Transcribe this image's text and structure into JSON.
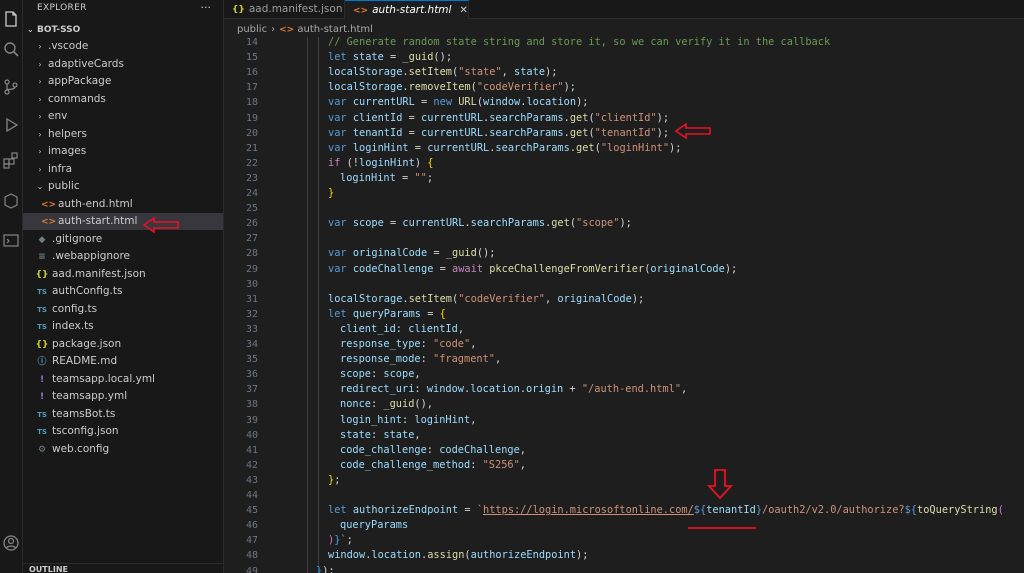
{
  "explorer": {
    "title": "EXPLORER",
    "more": "···",
    "project": "BOT-SSO",
    "tree": [
      {
        "label": ".vscode",
        "kind": "folder",
        "icon": "›"
      },
      {
        "label": "adaptiveCards",
        "kind": "folder",
        "icon": "›"
      },
      {
        "label": "appPackage",
        "kind": "folder",
        "icon": "›"
      },
      {
        "label": "commands",
        "kind": "folder",
        "icon": "›"
      },
      {
        "label": "env",
        "kind": "folder",
        "icon": "›"
      },
      {
        "label": "helpers",
        "kind": "folder",
        "icon": "›"
      },
      {
        "label": "images",
        "kind": "folder",
        "icon": "›"
      },
      {
        "label": "infra",
        "kind": "folder",
        "icon": "›"
      },
      {
        "label": "public",
        "kind": "folder-open",
        "icon": "⌄"
      },
      {
        "label": "auth-end.html",
        "kind": "html",
        "icon": "<>"
      },
      {
        "label": "auth-start.html",
        "kind": "html",
        "icon": "<>"
      },
      {
        "label": ".gitignore",
        "kind": "dots",
        "icon": "◆"
      },
      {
        "label": ".webappignore",
        "kind": "plain",
        "icon": "≡"
      },
      {
        "label": "aad.manifest.json",
        "kind": "json",
        "icon": "{}"
      },
      {
        "label": "authConfig.ts",
        "kind": "ts",
        "icon": "TS"
      },
      {
        "label": "config.ts",
        "kind": "ts",
        "icon": "TS"
      },
      {
        "label": "index.ts",
        "kind": "ts",
        "icon": "TS"
      },
      {
        "label": "package.json",
        "kind": "json",
        "icon": "{}"
      },
      {
        "label": "README.md",
        "kind": "info",
        "icon": "ⓘ"
      },
      {
        "label": "teamsapp.local.yml",
        "kind": "yml",
        "icon": "!"
      },
      {
        "label": "teamsapp.yml",
        "kind": "yml",
        "icon": "!"
      },
      {
        "label": "teamsBot.ts",
        "kind": "ts",
        "icon": "TS"
      },
      {
        "label": "tsconfig.json",
        "kind": "tsjson",
        "icon": "TS"
      },
      {
        "label": "web.config",
        "kind": "gear",
        "icon": "⚙"
      }
    ],
    "outline": "OUTLINE"
  },
  "tabs": [
    {
      "label": "aad.manifest.json",
      "icon": "{}"
    },
    {
      "label": "auth-start.html",
      "icon": "<>",
      "close": "✕"
    }
  ],
  "breadcrumb": {
    "folder": "public",
    "separator": "›",
    "file_icon": "<>",
    "file": "auth-start.html"
  },
  "code": [
    {
      "n": "14",
      "indent": 0,
      "t": [
        [
          "cm",
          "// Generate random state string and store it, so we can verify it in the callback"
        ]
      ]
    },
    {
      "n": "15",
      "indent": 0,
      "t": [
        [
          "kw",
          "let "
        ],
        [
          "var",
          "state"
        ],
        [
          "pl",
          " = "
        ],
        [
          "fn",
          "_guid"
        ],
        [
          "pl",
          "();"
        ]
      ]
    },
    {
      "n": "16",
      "indent": 0,
      "t": [
        [
          "var",
          "localStorage"
        ],
        [
          "pl",
          "."
        ],
        [
          "fn",
          "setItem"
        ],
        [
          "pl",
          "("
        ],
        [
          "str",
          "\"state\""
        ],
        [
          "pl",
          ", "
        ],
        [
          "var",
          "state"
        ],
        [
          "pl",
          ");"
        ]
      ]
    },
    {
      "n": "17",
      "indent": 0,
      "t": [
        [
          "var",
          "localStorage"
        ],
        [
          "pl",
          "."
        ],
        [
          "fn",
          "removeItem"
        ],
        [
          "pl",
          "("
        ],
        [
          "str",
          "\"codeVerifier\""
        ],
        [
          "pl",
          ");"
        ]
      ]
    },
    {
      "n": "18",
      "indent": 0,
      "t": [
        [
          "kw",
          "var "
        ],
        [
          "var",
          "currentURL"
        ],
        [
          "pl",
          " = "
        ],
        [
          "kw",
          "new "
        ],
        [
          "fn",
          "URL"
        ],
        [
          "pl",
          "("
        ],
        [
          "var",
          "window"
        ],
        [
          "pl",
          "."
        ],
        [
          "var",
          "location"
        ],
        [
          "pl",
          ");"
        ]
      ]
    },
    {
      "n": "19",
      "indent": 0,
      "t": [
        [
          "kw",
          "var "
        ],
        [
          "var",
          "clientId"
        ],
        [
          "pl",
          " = "
        ],
        [
          "var",
          "currentURL"
        ],
        [
          "pl",
          "."
        ],
        [
          "var",
          "searchParams"
        ],
        [
          "pl",
          "."
        ],
        [
          "fn",
          "get"
        ],
        [
          "pl",
          "("
        ],
        [
          "str",
          "\"clientId\""
        ],
        [
          "pl",
          ");"
        ]
      ]
    },
    {
      "n": "20",
      "indent": 0,
      "t": [
        [
          "kw",
          "var "
        ],
        [
          "var",
          "tenantId"
        ],
        [
          "pl",
          " = "
        ],
        [
          "var",
          "currentURL"
        ],
        [
          "pl",
          "."
        ],
        [
          "var",
          "searchParams"
        ],
        [
          "pl",
          "."
        ],
        [
          "fn",
          "get"
        ],
        [
          "pl",
          "("
        ],
        [
          "str",
          "\"tenantId\""
        ],
        [
          "pl",
          ");"
        ]
      ]
    },
    {
      "n": "21",
      "indent": 0,
      "t": [
        [
          "kw",
          "var "
        ],
        [
          "var",
          "loginHint"
        ],
        [
          "pl",
          " = "
        ],
        [
          "var",
          "currentURL"
        ],
        [
          "pl",
          "."
        ],
        [
          "var",
          "searchParams"
        ],
        [
          "pl",
          "."
        ],
        [
          "fn",
          "get"
        ],
        [
          "pl",
          "("
        ],
        [
          "str",
          "\"loginHint\""
        ],
        [
          "pl",
          ");"
        ]
      ]
    },
    {
      "n": "22",
      "indent": 0,
      "t": [
        [
          "ctl",
          "if "
        ],
        [
          "pl",
          "(!"
        ],
        [
          "var",
          "loginHint"
        ],
        [
          "pl",
          ") "
        ],
        [
          "br1",
          "{"
        ]
      ]
    },
    {
      "n": "23",
      "indent": 1,
      "t": [
        [
          "var",
          "loginHint"
        ],
        [
          "pl",
          " = "
        ],
        [
          "str",
          "\"\""
        ],
        [
          "pl",
          ";"
        ]
      ]
    },
    {
      "n": "24",
      "indent": 0,
      "t": [
        [
          "br1",
          "}"
        ]
      ]
    },
    {
      "n": "25",
      "indent": 0,
      "t": []
    },
    {
      "n": "26",
      "indent": 0,
      "t": [
        [
          "kw",
          "var "
        ],
        [
          "var",
          "scope"
        ],
        [
          "pl",
          " = "
        ],
        [
          "var",
          "currentURL"
        ],
        [
          "pl",
          "."
        ],
        [
          "var",
          "searchParams"
        ],
        [
          "pl",
          "."
        ],
        [
          "fn",
          "get"
        ],
        [
          "pl",
          "("
        ],
        [
          "str",
          "\"scope\""
        ],
        [
          "pl",
          ");"
        ]
      ]
    },
    {
      "n": "27",
      "indent": 0,
      "t": []
    },
    {
      "n": "28",
      "indent": 0,
      "t": [
        [
          "kw",
          "var "
        ],
        [
          "var",
          "originalCode"
        ],
        [
          "pl",
          " = "
        ],
        [
          "fn",
          "_guid"
        ],
        [
          "pl",
          "();"
        ]
      ]
    },
    {
      "n": "29",
      "indent": 0,
      "t": [
        [
          "kw",
          "var "
        ],
        [
          "var",
          "codeChallenge"
        ],
        [
          "pl",
          " = "
        ],
        [
          "ctl",
          "await "
        ],
        [
          "fn",
          "pkceChallengeFromVerifier"
        ],
        [
          "pl",
          "("
        ],
        [
          "var",
          "originalCode"
        ],
        [
          "pl",
          ");"
        ]
      ]
    },
    {
      "n": "30",
      "indent": 0,
      "t": []
    },
    {
      "n": "31",
      "indent": 0,
      "t": [
        [
          "var",
          "localStorage"
        ],
        [
          "pl",
          "."
        ],
        [
          "fn",
          "setItem"
        ],
        [
          "pl",
          "("
        ],
        [
          "str",
          "\"codeVerifier\""
        ],
        [
          "pl",
          ", "
        ],
        [
          "var",
          "originalCode"
        ],
        [
          "pl",
          ");"
        ]
      ]
    },
    {
      "n": "32",
      "indent": 0,
      "t": [
        [
          "kw",
          "let "
        ],
        [
          "var",
          "queryParams"
        ],
        [
          "pl",
          " = "
        ],
        [
          "br1",
          "{"
        ]
      ]
    },
    {
      "n": "33",
      "indent": 1,
      "t": [
        [
          "var",
          "client_id"
        ],
        [
          "pl",
          ": "
        ],
        [
          "var",
          "clientId"
        ],
        [
          "pl",
          ","
        ]
      ]
    },
    {
      "n": "34",
      "indent": 1,
      "t": [
        [
          "var",
          "response_type"
        ],
        [
          "pl",
          ": "
        ],
        [
          "str",
          "\"code\""
        ],
        [
          "pl",
          ","
        ]
      ]
    },
    {
      "n": "35",
      "indent": 1,
      "t": [
        [
          "var",
          "response_mode"
        ],
        [
          "pl",
          ": "
        ],
        [
          "str",
          "\"fragment\""
        ],
        [
          "pl",
          ","
        ]
      ]
    },
    {
      "n": "36",
      "indent": 1,
      "t": [
        [
          "var",
          "scope"
        ],
        [
          "pl",
          ": "
        ],
        [
          "var",
          "scope"
        ],
        [
          "pl",
          ","
        ]
      ]
    },
    {
      "n": "37",
      "indent": 1,
      "t": [
        [
          "var",
          "redirect_uri"
        ],
        [
          "pl",
          ": "
        ],
        [
          "var",
          "window"
        ],
        [
          "pl",
          "."
        ],
        [
          "var",
          "location"
        ],
        [
          "pl",
          "."
        ],
        [
          "var",
          "origin"
        ],
        [
          "pl",
          " + "
        ],
        [
          "str",
          "\"/auth-end.html\""
        ],
        [
          "pl",
          ","
        ]
      ]
    },
    {
      "n": "38",
      "indent": 1,
      "t": [
        [
          "var",
          "nonce"
        ],
        [
          "pl",
          ": "
        ],
        [
          "fn",
          "_guid"
        ],
        [
          "pl",
          "(),"
        ]
      ]
    },
    {
      "n": "39",
      "indent": 1,
      "t": [
        [
          "var",
          "login_hint"
        ],
        [
          "pl",
          ": "
        ],
        [
          "var",
          "loginHint"
        ],
        [
          "pl",
          ","
        ]
      ]
    },
    {
      "n": "40",
      "indent": 1,
      "t": [
        [
          "var",
          "state"
        ],
        [
          "pl",
          ": "
        ],
        [
          "var",
          "state"
        ],
        [
          "pl",
          ","
        ]
      ]
    },
    {
      "n": "41",
      "indent": 1,
      "t": [
        [
          "var",
          "code_challenge"
        ],
        [
          "pl",
          ": "
        ],
        [
          "var",
          "codeChallenge"
        ],
        [
          "pl",
          ","
        ]
      ]
    },
    {
      "n": "42",
      "indent": 1,
      "t": [
        [
          "var",
          "code_challenge_method"
        ],
        [
          "pl",
          ": "
        ],
        [
          "str",
          "\"S256\""
        ],
        [
          "pl",
          ","
        ]
      ]
    },
    {
      "n": "43",
      "indent": 0,
      "t": [
        [
          "br1",
          "}"
        ],
        [
          "pl",
          ";"
        ]
      ]
    },
    {
      "n": "44",
      "indent": 0,
      "t": []
    },
    {
      "n": "45",
      "indent": 0,
      "t": [
        [
          "kw",
          "let "
        ],
        [
          "var",
          "authorizeEndpoint"
        ],
        [
          "pl",
          " = "
        ],
        [
          "str",
          "`"
        ],
        [
          "url",
          "https://login.microsoftonline.com/"
        ],
        [
          "tmp",
          "${"
        ],
        [
          "var",
          "tenantId"
        ],
        [
          "tmp",
          "}"
        ],
        [
          "str",
          "/oauth2/v2.0/authorize?"
        ],
        [
          "tmp",
          "${"
        ],
        [
          "fn",
          "toQueryString"
        ],
        [
          "br2",
          "("
        ]
      ]
    },
    {
      "n": "46",
      "indent": 1,
      "t": [
        [
          "var",
          "queryParams"
        ]
      ]
    },
    {
      "n": "47",
      "indent": 0,
      "t": [
        [
          "br2",
          ")"
        ],
        [
          "tmp",
          "}"
        ],
        [
          "str",
          "`"
        ],
        [
          "pl",
          ";"
        ]
      ]
    },
    {
      "n": "48",
      "indent": 0,
      "t": [
        [
          "var",
          "window"
        ],
        [
          "pl",
          "."
        ],
        [
          "var",
          "location"
        ],
        [
          "pl",
          "."
        ],
        [
          "fn",
          "assign"
        ],
        [
          "pl",
          "("
        ],
        [
          "var",
          "authorizeEndpoint"
        ],
        [
          "pl",
          ");"
        ]
      ]
    },
    {
      "n": "49",
      "indent": -1,
      "t": [
        [
          "br3",
          "}"
        ],
        [
          "pl",
          ");"
        ]
      ]
    }
  ],
  "colors": {
    "accent": "#0078d4",
    "annotation": "#e81123"
  }
}
